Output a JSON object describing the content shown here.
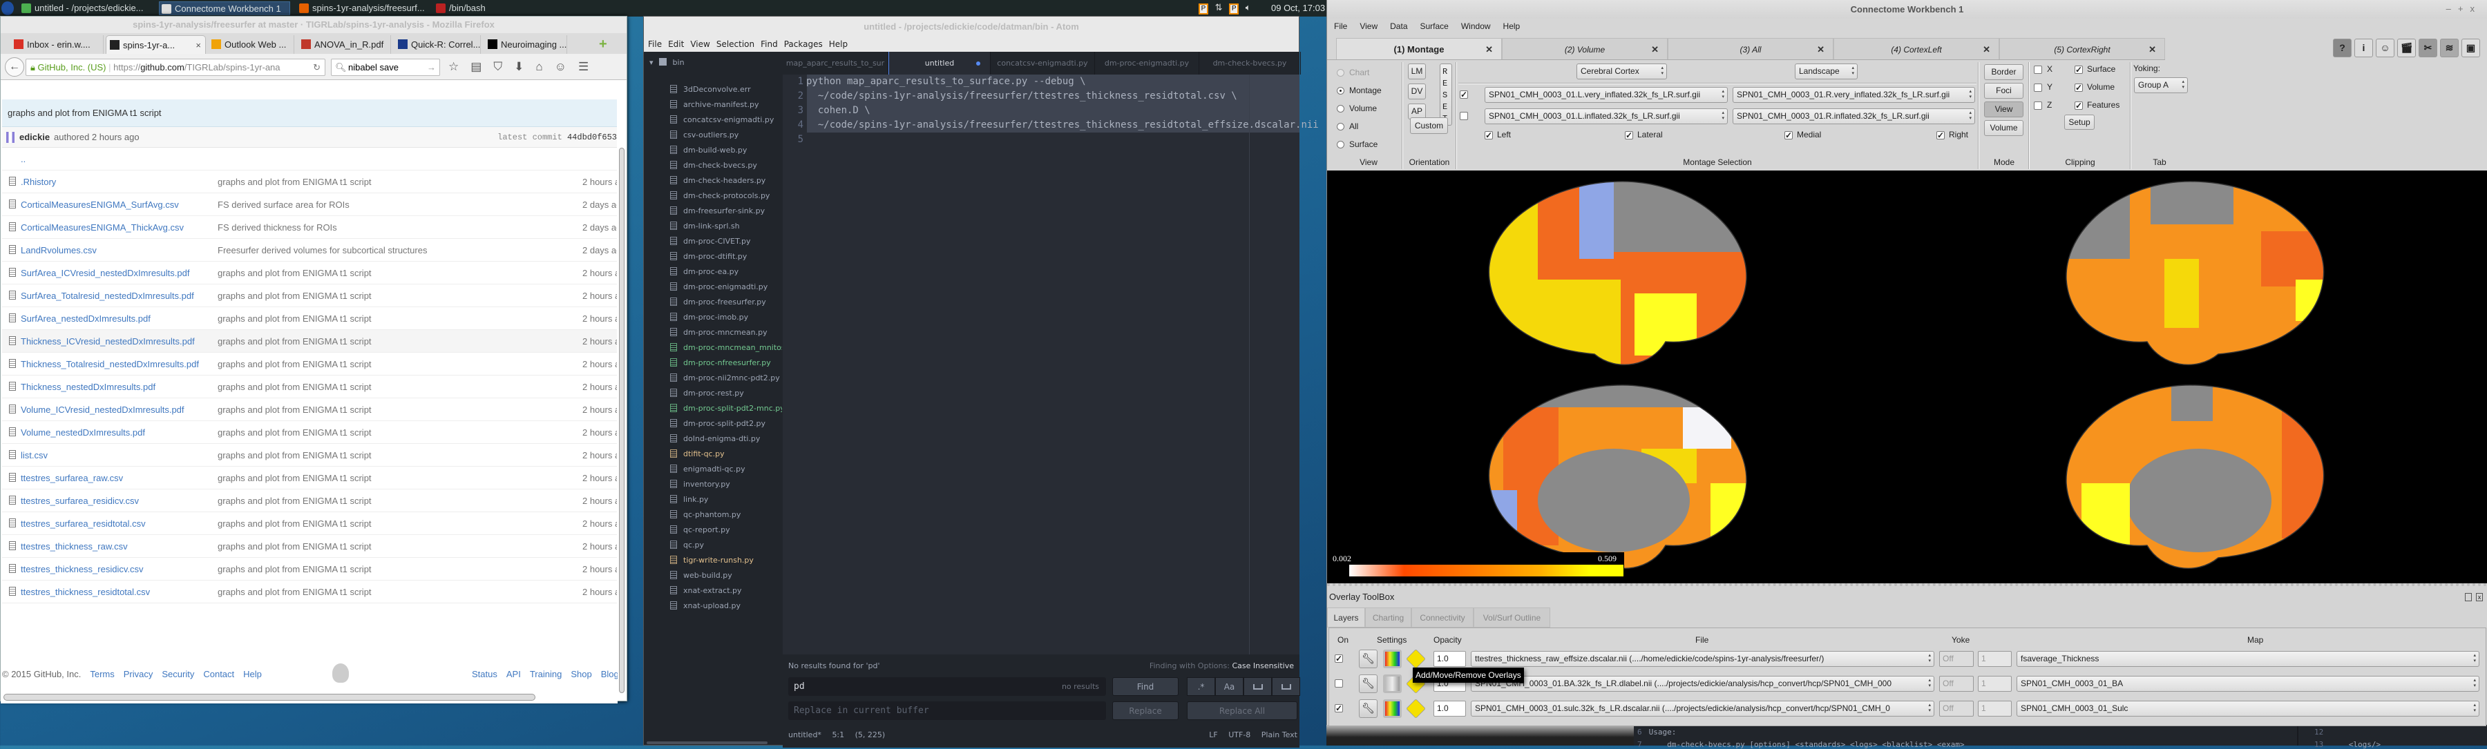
{
  "taskbar": {
    "apps": [
      {
        "label": "untitled - /projects/edickie...",
        "icon": "atom-icon",
        "active": false
      },
      {
        "label": "Connectome Workbench 1",
        "icon": "window-icon",
        "active": true
      },
      {
        "label": "spins-1yr-analysis/freesurf...",
        "icon": "firefox-icon",
        "active": false
      },
      {
        "label": "/bin/bash",
        "icon": "terminal-icon",
        "active": false
      }
    ],
    "clock": "09 Oct, 17:03"
  },
  "firefox": {
    "window_title": "spins-1yr-analysis/freesurfer at master · TIGRLab/spins-1yr-analysis - Mozilla Firefox",
    "tabs": [
      {
        "label": "Inbox - erin.w....",
        "icon": "gmail-icon",
        "color": "#d93025"
      },
      {
        "label": "spins-1yr-a...",
        "icon": "github-icon",
        "color": "#222222",
        "active": true
      },
      {
        "label": "Outlook Web ...",
        "icon": "outlook-icon",
        "color": "#f0a30a"
      },
      {
        "label": "ANOVA_in_R.pdf",
        "icon": "pdf-icon",
        "color": "#c0392b"
      },
      {
        "label": "Quick-R: Correl...",
        "icon": "quickr-icon",
        "color": "#1a3a8a"
      },
      {
        "label": "Neuroimaging ...",
        "icon": "black-square-icon",
        "color": "#000000"
      }
    ],
    "identity": "GitHub, Inc. (US)",
    "url_prefix": "https://",
    "url_host": "github.com",
    "url_path": "/TIGRLab/spins-1yr-ana",
    "search": "nibabel save",
    "commit_message": "graphs and plot from ENIGMA t1 script",
    "author": "edickie",
    "authored": "authored 2 hours ago",
    "latest_commit_label": "latest commit",
    "commit_hash": "44dbd0f653",
    "parent_dir": "..",
    "files": [
      {
        "name": ".Rhistory",
        "message": "graphs and plot from ENIGMA t1 script",
        "age": "2 hours ago"
      },
      {
        "name": "CorticalMeasuresENIGMA_SurfAvg.csv",
        "message": "FS derived surface area for ROIs",
        "age": "2 days ago"
      },
      {
        "name": "CorticalMeasuresENIGMA_ThickAvg.csv",
        "message": "FS derived thickness for ROIs",
        "age": "2 days ago"
      },
      {
        "name": "LandRvolumes.csv",
        "message": "Freesurfer derived volumes for subcortical structures",
        "age": "2 days ago"
      },
      {
        "name": "SurfArea_ICVresid_nestedDxImresults.pdf",
        "message": "graphs and plot from ENIGMA t1 script",
        "age": "2 hours ago"
      },
      {
        "name": "SurfArea_Totalresid_nestedDxImresults.pdf",
        "message": "graphs and plot from ENIGMA t1 script",
        "age": "2 hours ago"
      },
      {
        "name": "SurfArea_nestedDxImresults.pdf",
        "message": "graphs and plot from ENIGMA t1 script",
        "age": "2 hours ago"
      },
      {
        "name": "Thickness_ICVresid_nestedDxImresults.pdf",
        "message": "graphs and plot from ENIGMA t1 script",
        "age": "2 hours ago",
        "hover": true
      },
      {
        "name": "Thickness_Totalresid_nestedDxImresults.pdf",
        "message": "graphs and plot from ENIGMA t1 script",
        "age": "2 hours ago"
      },
      {
        "name": "Thickness_nestedDxImresults.pdf",
        "message": "graphs and plot from ENIGMA t1 script",
        "age": "2 hours ago"
      },
      {
        "name": "Volume_ICVresid_nestedDxImresults.pdf",
        "message": "graphs and plot from ENIGMA t1 script",
        "age": "2 hours ago"
      },
      {
        "name": "Volume_nestedDxImresults.pdf",
        "message": "graphs and plot from ENIGMA t1 script",
        "age": "2 hours ago"
      },
      {
        "name": "list.csv",
        "message": "graphs and plot from ENIGMA t1 script",
        "age": "2 hours ago"
      },
      {
        "name": "ttestres_surfarea_raw.csv",
        "message": "graphs and plot from ENIGMA t1 script",
        "age": "2 hours ago"
      },
      {
        "name": "ttestres_surfarea_residicv.csv",
        "message": "graphs and plot from ENIGMA t1 script",
        "age": "2 hours ago"
      },
      {
        "name": "ttestres_surfarea_residtotal.csv",
        "message": "graphs and plot from ENIGMA t1 script",
        "age": "2 hours ago"
      },
      {
        "name": "ttestres_thickness_raw.csv",
        "message": "graphs and plot from ENIGMA t1 script",
        "age": "2 hours ago"
      },
      {
        "name": "ttestres_thickness_residicv.csv",
        "message": "graphs and plot from ENIGMA t1 script",
        "age": "2 hours ago"
      },
      {
        "name": "ttestres_thickness_residtotal.csv",
        "message": "graphs and plot from ENIGMA t1 script",
        "age": "2 hours ago"
      }
    ],
    "footer_copyright": "© 2015 GitHub, Inc.",
    "footer_left": [
      "Terms",
      "Privacy",
      "Security",
      "Contact",
      "Help"
    ],
    "footer_right": [
      "Status",
      "API",
      "Training",
      "Shop",
      "Blog"
    ]
  },
  "atom": {
    "window_title": "untitled - /projects/edickie/code/datman/bin - Atom",
    "menu": [
      "File",
      "Edit",
      "View",
      "Selection",
      "Find",
      "Packages",
      "Help"
    ],
    "tree_root": "bin",
    "tree_files": [
      {
        "name": "3dDeconvolve.err",
        "status": "none"
      },
      {
        "name": "archive-manifest.py",
        "status": "none"
      },
      {
        "name": "concatcsv-enigmadti.py",
        "status": "none"
      },
      {
        "name": "csv-outliers.py",
        "status": "none"
      },
      {
        "name": "dm-build-web.py",
        "status": "none"
      },
      {
        "name": "dm-check-bvecs.py",
        "status": "none"
      },
      {
        "name": "dm-check-headers.py",
        "status": "none"
      },
      {
        "name": "dm-check-protocols.py",
        "status": "none"
      },
      {
        "name": "dm-freesurfer-sink.py",
        "status": "none"
      },
      {
        "name": "dm-link-sprl.sh",
        "status": "none"
      },
      {
        "name": "dm-proc-CIVET.py",
        "status": "none"
      },
      {
        "name": "dm-proc-dtifit.py",
        "status": "none"
      },
      {
        "name": "dm-proc-ea.py",
        "status": "none"
      },
      {
        "name": "dm-proc-enigmadti.py",
        "status": "none"
      },
      {
        "name": "dm-proc-freesurfer.py",
        "status": "none"
      },
      {
        "name": "dm-proc-imob.py",
        "status": "none"
      },
      {
        "name": "dm-proc-mncmean.py",
        "status": "none"
      },
      {
        "name": "dm-proc-mncmean_mnitoself",
        "status": "added"
      },
      {
        "name": "dm-proc-nfreesurfer.py",
        "status": "added"
      },
      {
        "name": "dm-proc-nii2mnc-pdt2.py",
        "status": "none"
      },
      {
        "name": "dm-proc-rest.py",
        "status": "none"
      },
      {
        "name": "dm-proc-split-pdt2-mnc.py",
        "status": "added"
      },
      {
        "name": "dm-proc-split-pdt2.py",
        "status": "none"
      },
      {
        "name": "doInd-enigma-dti.py",
        "status": "none"
      },
      {
        "name": "dtifit-qc.py",
        "status": "modified"
      },
      {
        "name": "enigmadti-qc.py",
        "status": "none"
      },
      {
        "name": "inventory.py",
        "status": "none"
      },
      {
        "name": "link.py",
        "status": "none"
      },
      {
        "name": "qc-phantom.py",
        "status": "none"
      },
      {
        "name": "qc-report.py",
        "status": "none"
      },
      {
        "name": "qc.py",
        "status": "none"
      },
      {
        "name": "tigr-write-runsh.py",
        "status": "modified"
      },
      {
        "name": "web-build.py",
        "status": "none"
      },
      {
        "name": "xnat-extract.py",
        "status": "none"
      },
      {
        "name": "xnat-upload.py",
        "status": "none"
      }
    ],
    "status_colors": {
      "none": "#9da5b4",
      "added": "#73c990",
      "modified": "#e2c08d"
    },
    "tabs": [
      {
        "label": "map_aparc_results_to_sur"
      },
      {
        "label": "untitled",
        "active": true,
        "modified": true
      },
      {
        "label": "concatcsv-enigmadti.py"
      },
      {
        "label": "dm-proc-enigmadti.py"
      },
      {
        "label": "dm-check-bvecs.py"
      }
    ],
    "code_lines": [
      "python map_aparc_results_to_surface.py --debug \\",
      "  ~/code/spins-1yr-analysis/freesurfer/ttestres_thickness_residtotal.csv \\",
      "  cohen.D \\",
      "  ~/code/spins-1yr-analysis/freesurfer/ttestres_thickness_residtotal_effsize.dscalar.nii",
      ""
    ],
    "find": {
      "status": "No results found for 'pd'",
      "options_label": "Finding with Options:",
      "options_value": "Case Insensitive",
      "query": "pd",
      "query_count": "no results",
      "find_button": "Find",
      "option_buttons": [
        ".*",
        "Aa",
        "",
        ""
      ],
      "replace_placeholder": "Replace in current buffer",
      "replace_button": "Replace",
      "replace_all_button": "Replace All"
    },
    "statusbar": {
      "file": "untitled*",
      "cursor": "5:1",
      "selection": "(5, 225)",
      "eol": "LF",
      "encoding": "UTF-8",
      "grammar": "Plain Text"
    }
  },
  "workbench": {
    "window_title": "Connectome Workbench 1",
    "menu": [
      "File",
      "View",
      "Data",
      "Surface",
      "Window",
      "Help"
    ],
    "tabs": [
      {
        "label": "(1) Montage",
        "active": true
      },
      {
        "label": "(2) Volume"
      },
      {
        "label": "(3) All"
      },
      {
        "label": "(4) CortexLeft"
      },
      {
        "label": "(5) CortexRight"
      }
    ],
    "toolbar_icons": [
      "help-icon",
      "info-icon",
      "identify-brain-icon",
      "movie-clapper-icon",
      "tools-icon",
      "layers-icon",
      "toolbox-icon"
    ],
    "view_group": {
      "options": [
        "Chart",
        "Montage",
        "Volume",
        "All",
        "Surface"
      ],
      "selected": "Montage",
      "disabled": [
        "Chart"
      ],
      "label": "View"
    },
    "orientation": {
      "buttons": [
        "LM",
        "DV",
        "AP"
      ],
      "reset": "RESET",
      "custom": "Custom",
      "label": "Orientation"
    },
    "montage": {
      "structure": "Cerebral Cortex",
      "layout": "Landscape",
      "rows": [
        {
          "checked": true,
          "left": "SPN01_CMH_0003_01.L.very_inflated.32k_fs_LR.surf.gii",
          "right": "SPN01_CMH_0003_01.R.very_inflated.32k_fs_LR.surf.gii"
        },
        {
          "checked": false,
          "left": "SPN01_CMH_0003_01.L.inflated.32k_fs_LR.surf.gii",
          "right": "SPN01_CMH_0003_01.R.inflated.32k_fs_LR.surf.gii"
        }
      ],
      "checks": [
        {
          "label": "Left",
          "checked": true
        },
        {
          "label": "Lateral",
          "checked": true
        },
        {
          "label": "Medial",
          "checked": true
        },
        {
          "label": "Right",
          "checked": true
        }
      ],
      "label": "Montage Selection"
    },
    "mode": {
      "buttons": [
        "Border",
        "Foci",
        "View",
        "Volume"
      ],
      "active": "View",
      "label": "Mode"
    },
    "clipping": {
      "axes": [
        {
          "label": "X",
          "checked": false
        },
        {
          "label": "Y",
          "checked": false
        },
        {
          "label": "Z",
          "checked": false
        }
      ],
      "items": [
        {
          "label": "Surface",
          "checked": true
        },
        {
          "label": "Volume",
          "checked": true
        },
        {
          "label": "Features",
          "checked": true
        }
      ],
      "setup": "Setup",
      "label": "Clipping"
    },
    "tab_group": {
      "yoking_label": "Yoking:",
      "yoking_value": "Group A",
      "label": "Tab"
    },
    "colorbar": {
      "min": "0.002",
      "max": "0.509",
      "palette": [
        "#ffffff",
        "#ff4a00",
        "#ff7a00",
        "#ffb000",
        "#ffff00"
      ]
    },
    "surface_colors": {
      "orange": "#f26a1f",
      "light_orange": "#f7931e",
      "yellow": "#f5d90a",
      "bright_yellow": "#ffff22",
      "blue": "#8fa6e6",
      "gray": "#8a8a8a"
    },
    "overlay_toolbox": {
      "title": "Overlay ToolBox",
      "tabs": [
        {
          "label": "Layers",
          "active": true
        },
        {
          "label": "Charting"
        },
        {
          "label": "Connectivity"
        },
        {
          "label": "Vol/Surf Outline"
        }
      ],
      "headers": {
        "on": "On",
        "settings": "Settings",
        "opacity": "Opacity",
        "file": "File",
        "yoke": "Yoke",
        "map": "Map"
      },
      "layers": [
        {
          "on": true,
          "palette_active": true,
          "opacity": "1.0",
          "file": "ttestres_thickness_raw_effsize.dscalar.nii (..../home/edickie/code/spins-1yr-analysis/freesurfer/)",
          "yoke": "Off",
          "index": "1",
          "map": "fsaverage_Thickness"
        },
        {
          "on": false,
          "palette_active": false,
          "opacity": "1.0",
          "file": "SPN01_CMH_0003_01.BA.32k_fs_LR.dlabel.nii (..../projects/edickie/analysis/hcp_convert/hcp/SPN01_CMH_000",
          "yoke": "Off",
          "index": "1",
          "map": "SPN01_CMH_0003_01_BA"
        },
        {
          "on": true,
          "palette_active": true,
          "opacity": "1.0",
          "file": "SPN01_CMH_0003_01.sulc.32k_fs_LR.dscalar.nii (..../projects/edickie/analysis/hcp_convert/hcp/SPN01_CMH_0",
          "yoke": "Off",
          "index": "1",
          "map": "SPN01_CMH_0003_01_Sulc"
        }
      ],
      "tooltip": "Add/Move/Remove Overlays"
    }
  },
  "background_editor": {
    "lines": [
      {
        "num": "6",
        "text": "Usage:"
      },
      {
        "num": "7",
        "text": "    dm-check-bvecs.py [options] <standards> <logs> <blacklist> <exam>"
      }
    ],
    "right_lines": [
      {
        "num": "12",
        "text": ""
      },
      {
        "num": "13",
        "text": "    <logs/>"
      }
    ]
  }
}
